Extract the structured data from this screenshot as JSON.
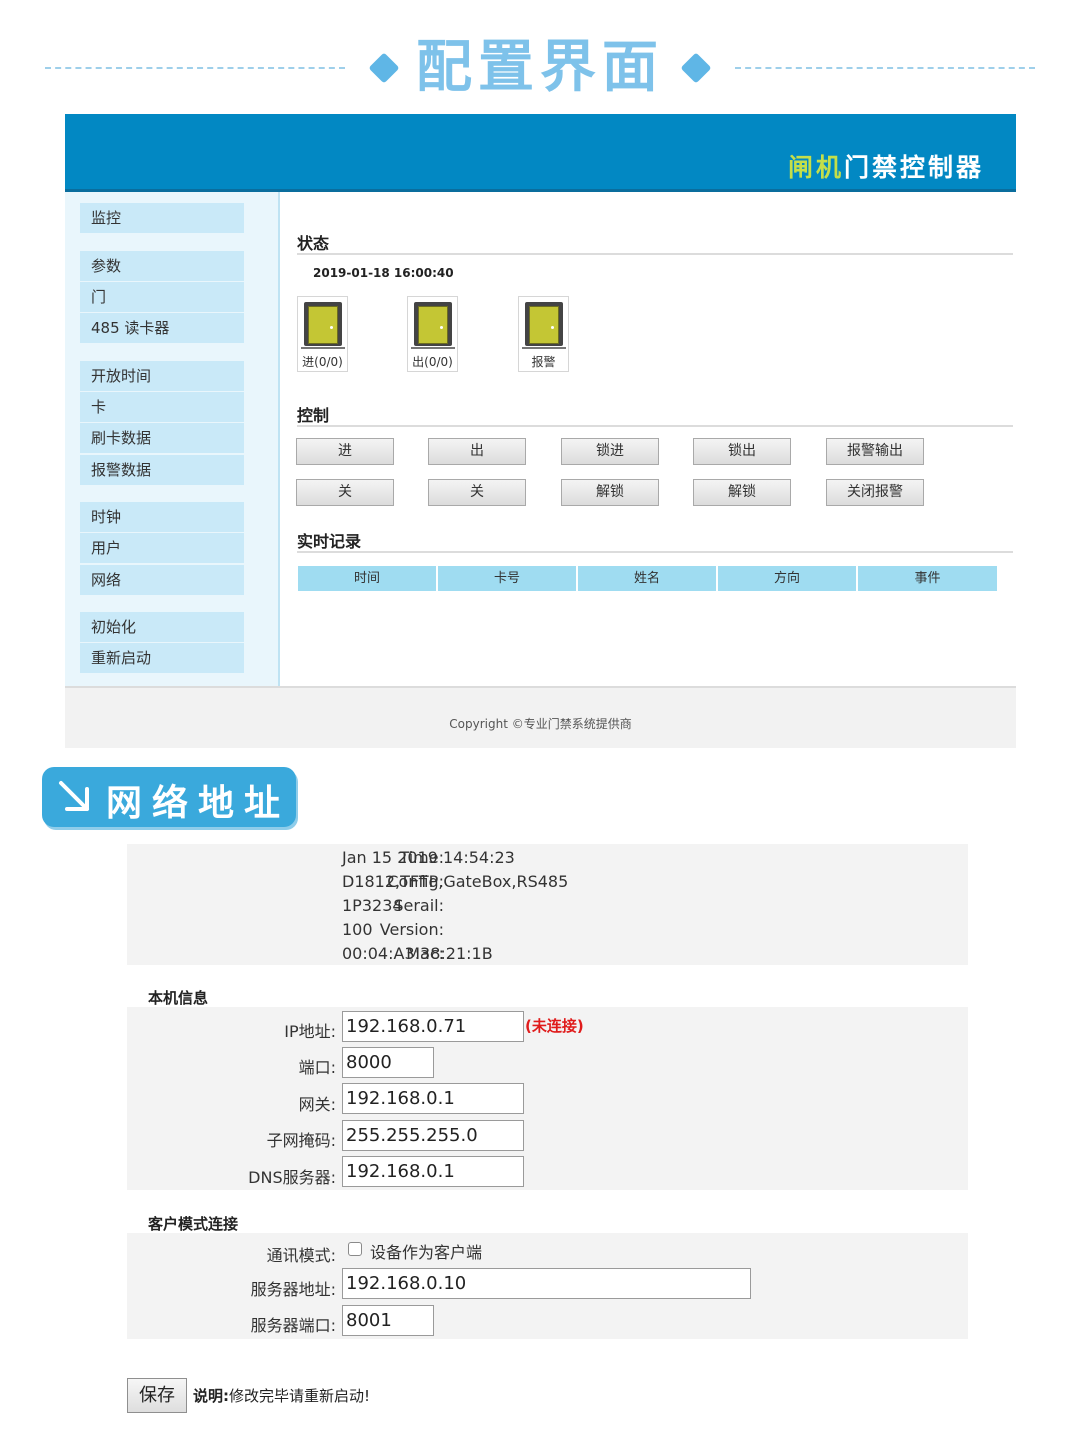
{
  "heading": {
    "title": "配置界面"
  },
  "app": {
    "title_accent": "闸机",
    "title_rest": "门禁控制器",
    "sidebar": {
      "items": [
        "监控",
        "参数",
        "门",
        "485 读卡器",
        "开放时间",
        "卡",
        "刷卡数据",
        "报警数据",
        "时钟",
        "用户",
        "网络",
        "初始化",
        "重新启动"
      ]
    },
    "status": {
      "title": "状态",
      "datetime": "2019-01-18 16:00:40",
      "doors": [
        {
          "label": "进(0/0)"
        },
        {
          "label": "出(0/0)"
        },
        {
          "label": "报警"
        }
      ]
    },
    "control": {
      "title": "控制",
      "row1": [
        "进",
        "出",
        "锁进",
        "锁出",
        "报警输出"
      ],
      "row2": [
        "关",
        "关",
        "解锁",
        "解锁",
        "关闭报警"
      ]
    },
    "records": {
      "title": "实时记录",
      "columns": [
        "时间",
        "卡号",
        "姓名",
        "方向",
        "事件"
      ]
    },
    "footer": {
      "copyright": "Copyright ©专业门禁系统提供商"
    }
  },
  "colors": {
    "header_bg": "#0288c3",
    "accent_green": "#c4df4a",
    "nav_item_bg": "#c9e9f8",
    "table_head_bg": "#9fdcf1",
    "error_red": "#e01b1b"
  },
  "banner": {
    "text": "网络地址",
    "icon": "arrow-down-right-icon"
  },
  "network": {
    "info": [
      {
        "label": "Time:",
        "value": "Jan 15 2019 14:54:23"
      },
      {
        "label": "Config:",
        "value": "D1812,TFTP,GateBox,RS485"
      },
      {
        "label": "Serail:",
        "value": "1P3234"
      },
      {
        "label": "Version:",
        "value": "100"
      },
      {
        "label": "Mac:",
        "value": "00:04:A3:38:21:1B"
      }
    ],
    "local": {
      "title": "本机信息",
      "ip_label": "IP地址:",
      "ip": "192.168.0.71",
      "status": "(未连接)",
      "port_label": "端口:",
      "port": "8000",
      "gateway_label": "网关:",
      "gateway": "192.168.0.1",
      "mask_label": "子网掩码:",
      "mask": "255.255.255.0",
      "dns_label": "DNS服务器:",
      "dns": "192.168.0.1"
    },
    "client": {
      "title": "客户模式连接",
      "mode_label": "通讯模式:",
      "mode_checkbox_label": "设备作为客户端",
      "mode_checked": false,
      "server_label": "服务器地址:",
      "server": "192.168.0.10",
      "server_port_label": "服务器端口:",
      "server_port": "8001"
    },
    "save_label": "保存",
    "note_prefix": "说明:",
    "note_text": "修改完毕请重新启动!"
  }
}
